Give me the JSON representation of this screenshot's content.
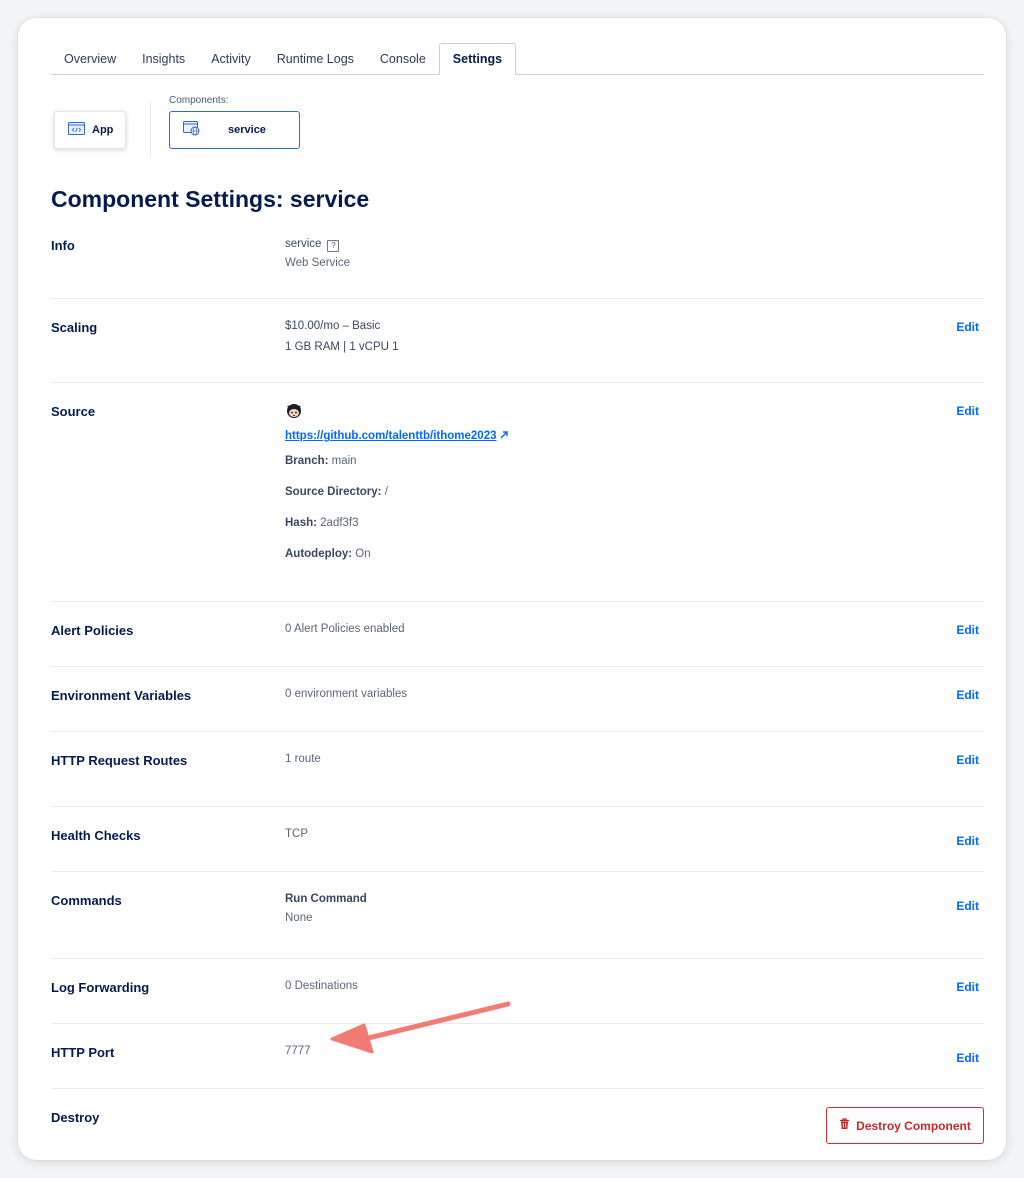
{
  "tabs": [
    {
      "label": "Overview"
    },
    {
      "label": "Insights"
    },
    {
      "label": "Activity"
    },
    {
      "label": "Runtime Logs"
    },
    {
      "label": "Console"
    },
    {
      "label": "Settings",
      "active": true
    }
  ],
  "components": {
    "label": "Components:",
    "app": "App",
    "service": "service"
  },
  "page_title": "Component Settings: service",
  "sections": {
    "info": {
      "label": "Info",
      "name": "service",
      "help_glyph": "?",
      "type": "Web Service"
    },
    "scaling": {
      "label": "Scaling",
      "plan": "$10.00/mo – Basic",
      "specs": "1 GB RAM | 1 vCPU 1",
      "edit": "Edit"
    },
    "source": {
      "label": "Source",
      "url": "https://github.com/talenttb/ithome2023",
      "branch_key": "Branch:",
      "branch_val": "main",
      "dir_key": "Source Directory:",
      "dir_val": "/",
      "hash_key": "Hash:",
      "hash_val": "2adf3f3",
      "autodeploy_key": "Autodeploy:",
      "autodeploy_val": "On",
      "edit": "Edit"
    },
    "alerts": {
      "label": "Alert Policies",
      "value": "0 Alert Policies enabled",
      "edit": "Edit"
    },
    "env": {
      "label": "Environment Variables",
      "value": "0 environment variables",
      "edit": "Edit"
    },
    "routes": {
      "label": "HTTP Request Routes",
      "value": "1 route",
      "edit": "Edit"
    },
    "health": {
      "label": "Health Checks",
      "value": "TCP",
      "edit": "Edit"
    },
    "commands": {
      "label": "Commands",
      "value_title": "Run Command",
      "value": "None",
      "edit": "Edit"
    },
    "logs": {
      "label": "Log Forwarding",
      "value": "0 Destinations",
      "edit": "Edit"
    },
    "port": {
      "label": "HTTP Port",
      "value": "7777",
      "edit": "Edit"
    },
    "destroy": {
      "label": "Destroy",
      "button": "Destroy Component"
    }
  },
  "colors": {
    "accent": "#0069ff",
    "danger": "#d32f2f",
    "annotation_arrow": "#f27b73",
    "title": "#031b4e"
  }
}
